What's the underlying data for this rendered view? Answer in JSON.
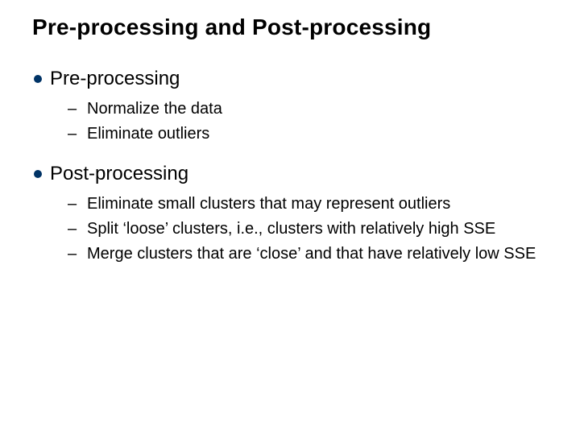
{
  "title": "Pre-processing and Post-processing",
  "sections": [
    {
      "heading": "Pre-processing",
      "items": [
        "Normalize the data",
        "Eliminate outliers"
      ]
    },
    {
      "heading": "Post-processing",
      "items": [
        "Eliminate small clusters that may represent outliers",
        "Split ‘loose’ clusters, i.e., clusters with relatively high SSE",
        "Merge clusters that are ‘close’ and that have relatively low SSE"
      ]
    }
  ],
  "colors": {
    "bullet": "#003366"
  }
}
